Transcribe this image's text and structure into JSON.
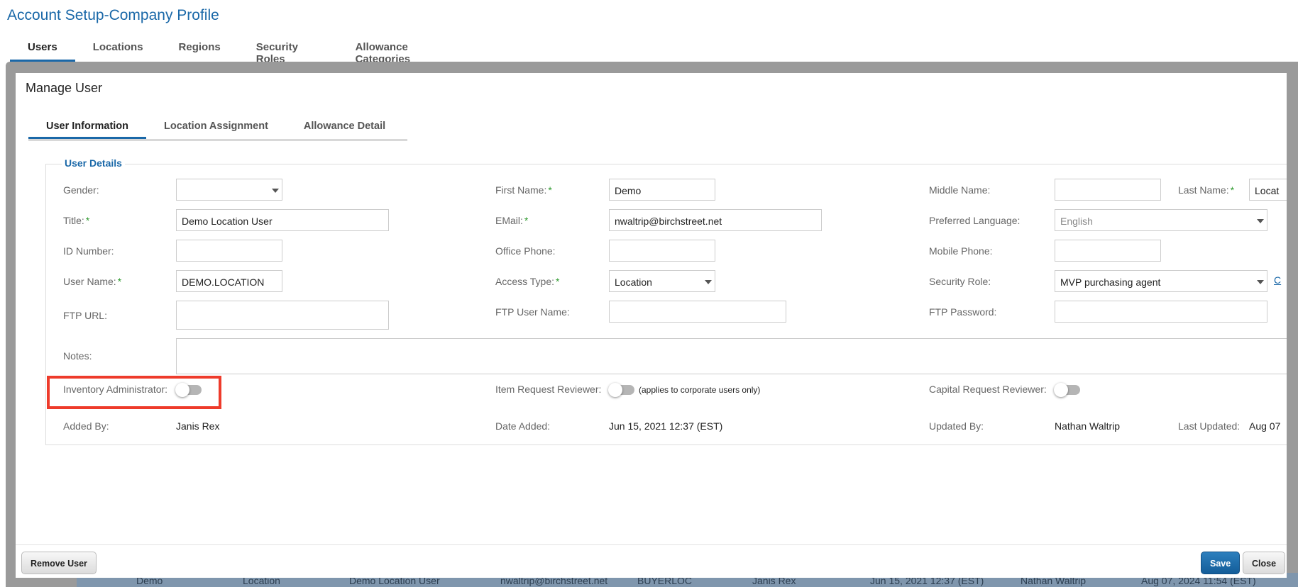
{
  "page": {
    "title": "Account Setup-Company Profile"
  },
  "top_tabs": [
    {
      "label": "Users",
      "active": true
    },
    {
      "label": "Locations",
      "active": false
    },
    {
      "label": "Regions",
      "active": false
    },
    {
      "label": "Security Roles",
      "active": false
    },
    {
      "label": "Allowance Categories",
      "active": false
    }
  ],
  "background_row": {
    "first_name": "Demo",
    "access_type": "Location",
    "title": "Demo Location User",
    "email": "nwaltrip@birchstreet.net",
    "user_name": "BUYERLOC",
    "added_by": "Janis Rex",
    "date_added": "Jun 15, 2021 12:37 (EST)",
    "updated_by": "Nathan Waltrip",
    "last_updated": "Aug 07, 2024 11:54 (EST)"
  },
  "modal": {
    "title": "Manage User",
    "tabs": [
      {
        "label": "User Information",
        "active": true
      },
      {
        "label": "Location Assignment",
        "active": false
      },
      {
        "label": "Allowance Detail",
        "active": false
      }
    ],
    "section_title": "User Details",
    "fields": {
      "gender": {
        "label": "Gender:",
        "value": ""
      },
      "first_name": {
        "label": "First Name:",
        "value": "Demo"
      },
      "middle_name": {
        "label": "Middle Name:",
        "value": ""
      },
      "last_name": {
        "label": "Last Name:",
        "value": "Locat"
      },
      "title": {
        "label": "Title:",
        "value": "Demo Location User"
      },
      "email": {
        "label": "EMail:",
        "value": "nwaltrip@birchstreet.net"
      },
      "preferred_language": {
        "label": "Preferred Language:",
        "value": "English"
      },
      "id_number": {
        "label": "ID Number:",
        "value": ""
      },
      "office_phone": {
        "label": "Office Phone:",
        "value": ""
      },
      "mobile_phone": {
        "label": "Mobile Phone:",
        "value": ""
      },
      "user_name": {
        "label": "User Name:",
        "value": "DEMO.LOCATION"
      },
      "access_type": {
        "label": "Access Type:",
        "value": "Location"
      },
      "security_role": {
        "label": "Security Role:",
        "value": "MVP purchasing agent",
        "link_partial": "C"
      },
      "ftp_url": {
        "label": "FTP URL:",
        "value": ""
      },
      "ftp_user_name": {
        "label": "FTP User Name:",
        "value": ""
      },
      "ftp_password": {
        "label": "FTP Password:",
        "value": ""
      },
      "notes": {
        "label": "Notes:",
        "value": ""
      }
    },
    "required_marker": "*",
    "toggles": {
      "inventory_admin": {
        "label": "Inventory Administrator:",
        "on": false
      },
      "item_request_reviewer": {
        "label": "Item Request Reviewer:",
        "note": "(applies to corporate users only)",
        "on": false
      },
      "capital_request_reviewer": {
        "label": "Capital Request Reviewer:",
        "on": false
      }
    },
    "meta": {
      "added_by": {
        "label": "Added By:",
        "value": "Janis Rex"
      },
      "date_added": {
        "label": "Date Added:",
        "value": "Jun 15, 2021 12:37 (EST)"
      },
      "updated_by": {
        "label": "Updated By:",
        "value": "Nathan Waltrip"
      },
      "last_updated": {
        "label": "Last Updated:",
        "value": "Aug 07"
      }
    },
    "buttons": {
      "remove_user": "Remove User",
      "save": "Save",
      "close": "Close"
    }
  },
  "colors": {
    "accent": "#1a68a8",
    "required": "#2e9a2e",
    "highlight": "#ee3b2b",
    "overlay": "#9a9a9a"
  }
}
